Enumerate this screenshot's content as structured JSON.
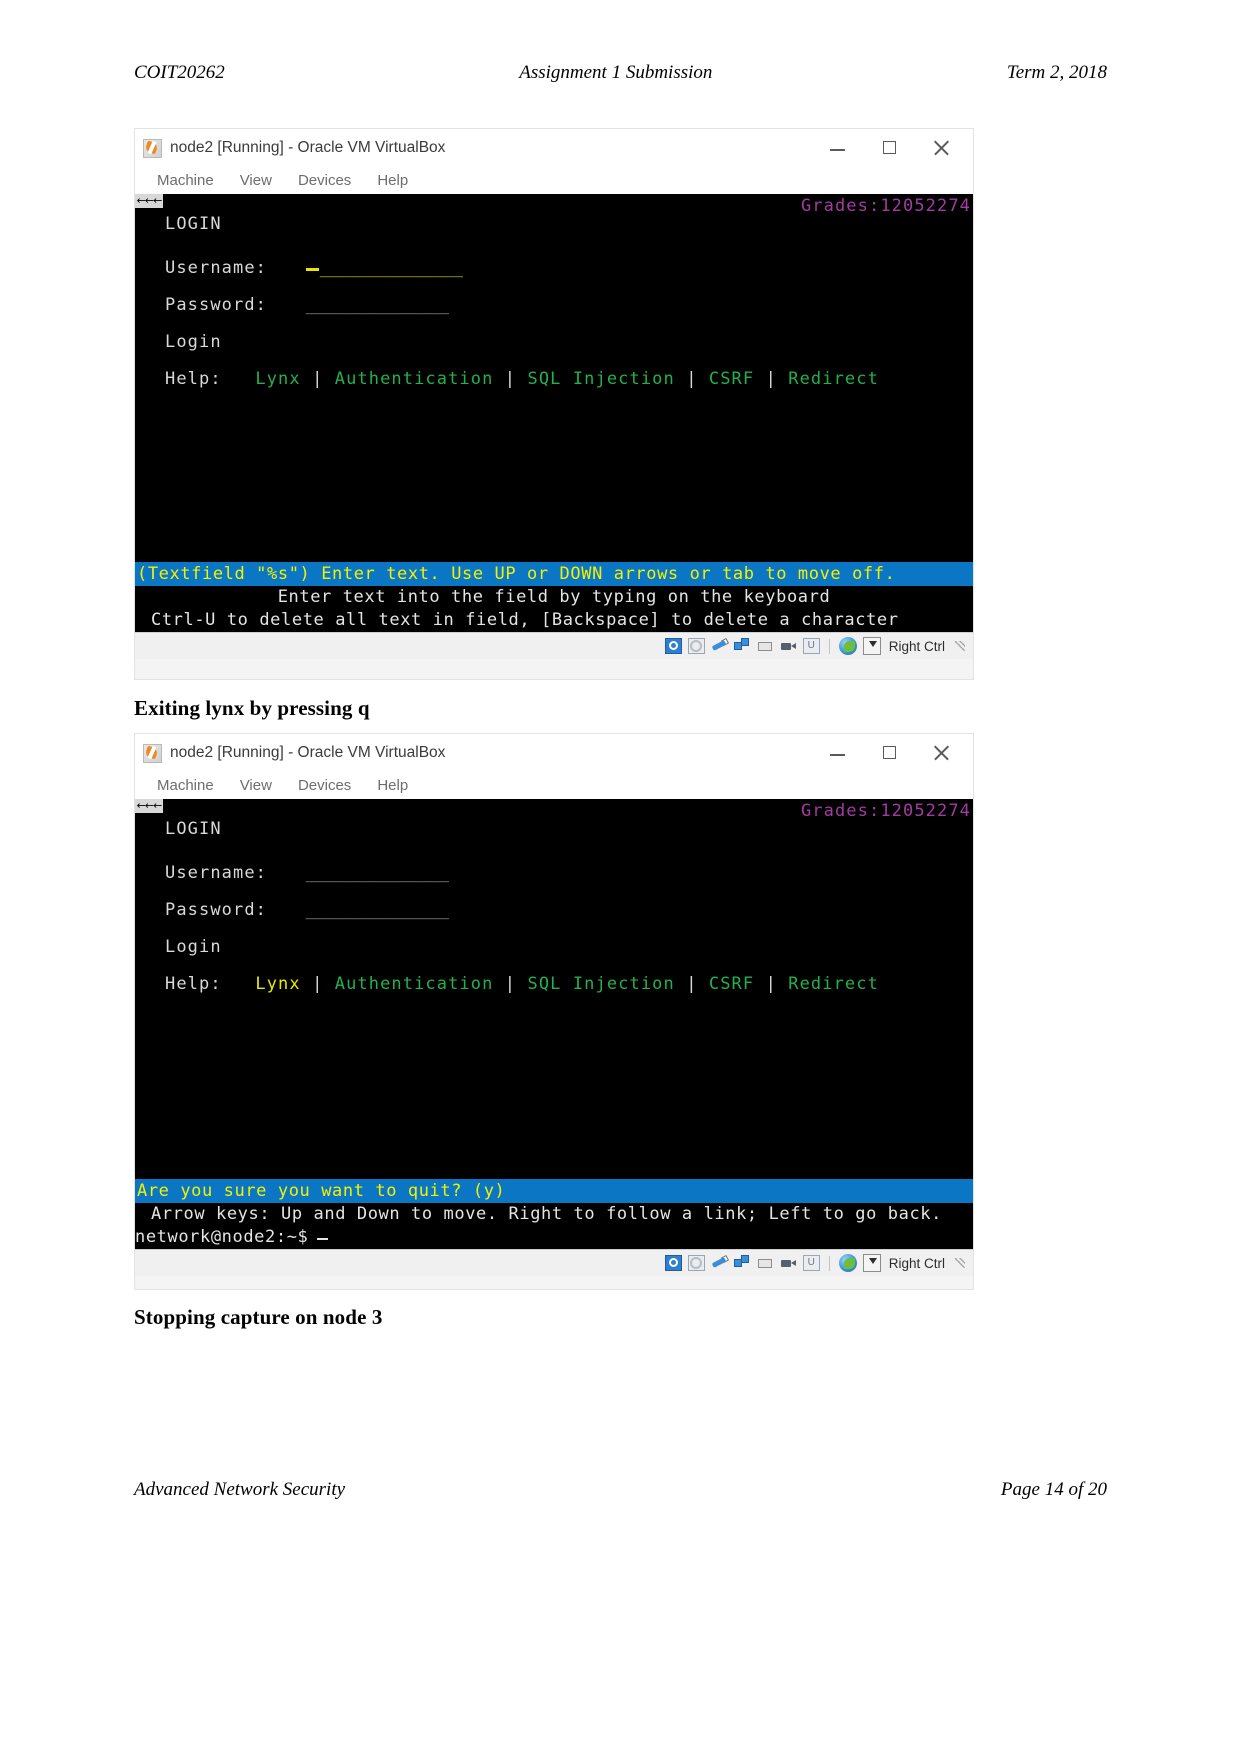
{
  "document": {
    "header": {
      "left": "COIT20262",
      "center": "Assignment 1 Submission",
      "right": "Term 2, 2018"
    },
    "footer": {
      "left": "Advanced Network Security",
      "right": "Page 14 of 20"
    },
    "captions": {
      "first": "Exiting lynx by pressing q",
      "second": "Stopping capture on node 3"
    }
  },
  "vbox": {
    "title": "node2 [Running] - Oracle VM VirtualBox",
    "menu": [
      "Machine",
      "View",
      "Devices",
      "Help"
    ],
    "window_controls": {
      "minimize": "—",
      "maximize": "□",
      "close": "✕"
    },
    "statusbar": {
      "icons": [
        "hard-disk-icon",
        "optical-disk-icon",
        "usb-icon",
        "network-icon",
        "shared-folders-icon",
        "video-capture-icon",
        "cpu-icon"
      ],
      "host_key_icons": [
        "globe-icon",
        "host-key-icon"
      ],
      "host_key_label": "Right Ctrl"
    }
  },
  "screenshot_1": {
    "scroll_marker": "←←←",
    "grades_label": "Grades:12052274",
    "lines": {
      "heading": "LOGIN",
      "username_label": "Username:",
      "username_field": "______________",
      "password_label": "Password:",
      "password_field": "______________",
      "submit": "Login",
      "help_label": "Help:",
      "links": [
        "Lynx",
        "Authentication",
        "SQL Injection",
        "CSRF",
        "Redirect"
      ],
      "link_separator": "|",
      "selected_link": ""
    },
    "status": {
      "blue": "(Textfield \"%s\") Enter text. Use UP or DOWN arrows or tab to move off.",
      "line2": "Enter text into the field by typing on the keyboard",
      "line3": "Ctrl-U to delete all text in field, [Backspace] to delete a character"
    }
  },
  "screenshot_2": {
    "scroll_marker": "←←←",
    "grades_label": "Grades:12052274",
    "lines": {
      "heading": "LOGIN",
      "username_label": "Username:",
      "username_field": "______________",
      "password_label": "Password:",
      "password_field": "______________",
      "submit": "Login",
      "help_label": "Help:",
      "links": [
        "Lynx",
        "Authentication",
        "SQL Injection",
        "CSRF",
        "Redirect"
      ],
      "link_separator": "|",
      "selected_link": "Lynx"
    },
    "status": {
      "blue": "Are you sure you want to quit? (y)",
      "line2": "Arrow keys: Up and Down to move.  Right to follow a link; Left to go back.",
      "line3": "network@node2:~$"
    }
  },
  "colors": {
    "link_green": "#22b14c",
    "selected_yellow": "#e9e900",
    "status_blue_bg": "#0b76c4",
    "status_blue_fg": "#f2f200",
    "grades_magenta": "#a33ba3",
    "terminal_bg": "#000000",
    "terminal_fg": "#d9d9d9"
  }
}
